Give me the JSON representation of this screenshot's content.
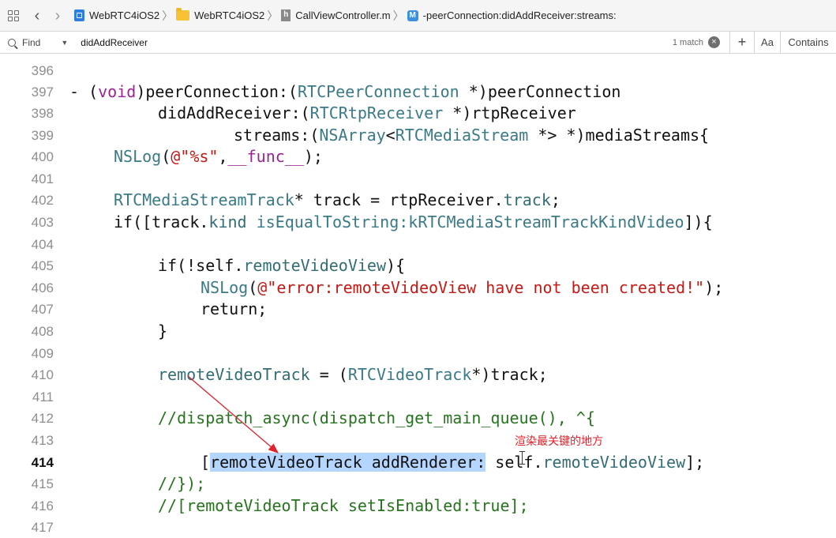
{
  "jumpbar": {
    "breadcrumbs": [
      {
        "label": "WebRTC4iOS2",
        "icon": "project-icon"
      },
      {
        "label": "WebRTC4iOS2",
        "icon": "folder-icon"
      },
      {
        "label": "CallViewController.m",
        "icon": "objc-file-icon",
        "badge": "h"
      },
      {
        "label": "-peerConnection:didAddReceiver:streams:",
        "icon": "method-icon",
        "badge": "M"
      }
    ]
  },
  "find": {
    "mode": "Find",
    "query": "didAddReceiver",
    "match_count": "1 match",
    "clear": "×",
    "add": "+",
    "case_label": "Aa",
    "match_type": "Contains"
  },
  "editor": {
    "current_line": "414",
    "lines": [
      {
        "n": "396"
      },
      {
        "n": "397"
      },
      {
        "n": "398"
      },
      {
        "n": "399"
      },
      {
        "n": "400"
      },
      {
        "n": "401"
      },
      {
        "n": "402"
      },
      {
        "n": "403"
      },
      {
        "n": "404"
      },
      {
        "n": "405"
      },
      {
        "n": "406"
      },
      {
        "n": "407"
      },
      {
        "n": "408"
      },
      {
        "n": "409"
      },
      {
        "n": "410"
      },
      {
        "n": "411"
      },
      {
        "n": "412"
      },
      {
        "n": "413"
      },
      {
        "n": "414"
      },
      {
        "n": "415"
      },
      {
        "n": "416"
      },
      {
        "n": "417"
      }
    ],
    "code": {
      "l397": {
        "dash": "- ",
        "lparen": "(",
        "void": "void",
        "a": ")peerConnection:(",
        "t1": "RTCPeerConnection",
        "b": " *)peerConnection"
      },
      "l398": {
        "a": "didAddReceiver:(",
        "t1": "RTCRtpReceiver",
        "b": " *)rtpReceiver"
      },
      "l399": {
        "a": "streams:(",
        "t1": "NSArray",
        "lt": "<",
        "t2": "RTCMediaStream",
        "b": " *> *)mediaStreams{"
      },
      "l400": {
        "fn": "NSLog",
        "p1": "(",
        "s": "@\"%s\"",
        "c": ",",
        "k": "__func__",
        "e": ");"
      },
      "l402": {
        "t1": "RTCMediaStreamTrack",
        "a": "* track = rtpReceiver.",
        "p": "track",
        "e": ";"
      },
      "l403": {
        "a": "if([track.",
        "p": "kind",
        "sp": " ",
        "m": "isEqualToString:",
        "k": "kRTCMediaStreamTrackKindVideo",
        "e": "]){"
      },
      "l405": {
        "a": "if(!self.",
        "p": "remoteVideoView",
        "e": "){"
      },
      "l406": {
        "fn": "NSLog",
        "p1": "(",
        "s": "@\"error:remoteVideoView have not been created!\"",
        "e": ");"
      },
      "l407": {
        "a": "return;"
      },
      "l408": {
        "a": "}"
      },
      "l410": {
        "v": "remoteVideoTrack",
        "a": " = (",
        "t1": "RTCVideoTrack",
        "e": "*)track;"
      },
      "l412": {
        "c": "//dispatch_async(dispatch_get_main_queue(), ^{"
      },
      "l414": {
        "lb": "[",
        "hl": "remoteVideoTrack addRenderer:",
        "a": " self.",
        "p": "remoteVideoView",
        "e": "];"
      },
      "l415": {
        "c": "//});"
      },
      "l416": {
        "c": "//[remoteVideoTrack setIsEnabled:true];"
      }
    },
    "annotation": "渲染最关键的地方",
    "annotation_color": "#e0222b"
  },
  "colors": {
    "keyword": "#9b2393",
    "type": "#3a7a87",
    "string": "#c41a16",
    "comment": "#26741d",
    "selection": "#b4d5fe"
  }
}
